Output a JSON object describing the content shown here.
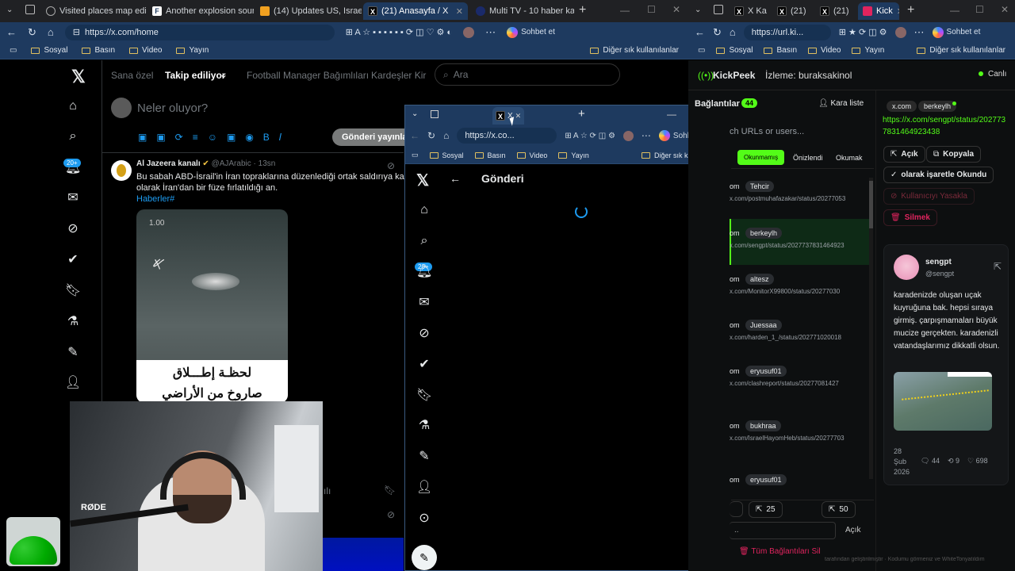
{
  "browser_main": {
    "tabs": [
      {
        "label": "",
        "icon": "vertical-tabs-icon"
      },
      {
        "label": "Visited places map editor",
        "icon": "globe-icon"
      },
      {
        "label": "Another explosion sound a",
        "icon": "generic-page-icon"
      },
      {
        "label": "(14) Updates US, Israel atta",
        "icon": "orange-site-icon"
      },
      {
        "label": "(21) Anasayfa / X",
        "icon": "x-logo-icon"
      },
      {
        "label": "Multi TV - 10 haber ka",
        "icon": "tv-icon"
      }
    ],
    "url": "https://x.com/home",
    "copilot_label": "Sohbet et",
    "bookmarks": [
      "Sosyal",
      "Basın",
      "Video",
      "Yayın"
    ],
    "other_bookmarks": "Diğer sık kullanılanlar"
  },
  "x_home": {
    "nav_tabs": [
      "Sana özel",
      "Takip ediliyor",
      "Football Manager Bağımlıları",
      "Kardeşler Kir"
    ],
    "search_placeholder": "Ara",
    "compose_placeholder": "Neler oluyor?",
    "post_button": "Gönderi yayınla",
    "notif_badge": "20+",
    "tweet": {
      "author": "Al Jazeera kanalı",
      "handle": "@AJArabic",
      "time": "13sn",
      "text_line1": "Bu sabah ABD-İsrail'in İran topraklarına düzenlediği ortak saldırıya karşılık",
      "text_line2": "olarak İran'dan bir füze fırlatıldığı an.",
      "hashtag": "Haberler#",
      "video_time": "1.00",
      "arabic_caption_1": "لحظـة إطـــلاق",
      "arabic_caption_2": "صاروخ من الأراضي"
    }
  },
  "popup": {
    "url": "https://x.co...",
    "copilot_label": "Sohbet et",
    "bookmarks": [
      "Sosyal",
      "Basın",
      "Video",
      "Yayın"
    ],
    "other_bookmarks": "Diğer sık kullanılanlar",
    "page_title": "Gönderi",
    "notif_badge": "20+"
  },
  "browser_right": {
    "tabs": [
      "X Ka",
      "(21)",
      "(21)",
      "Kick"
    ],
    "url": "https://url.ki...",
    "copilot_label": "Sohbet et",
    "bookmarks": [
      "Sosyal",
      "Basın",
      "Video",
      "Yayın"
    ],
    "other_bookmarks": "Diğer sık kullanılanlar"
  },
  "kickpeek": {
    "brand": "KickPeek",
    "watching": "İzleme: buraksakinol",
    "live_label": "Canlı",
    "links_label": "Bağlantılar",
    "links_count": "44",
    "blacklist": "Kara liste",
    "search_placeholder": "ch URLs or users...",
    "filter_tabs": [
      "Okunmamış",
      "Önizlendi",
      "Okumak"
    ],
    "rows": [
      {
        "prefix": "om",
        "user": "Tehcir",
        "url": "x.com/postmuhafazakar/status/20277053"
      },
      {
        "prefix": "om",
        "user": "berkeylh",
        "url": "x.com/sengpt/status/2027737831464923"
      },
      {
        "prefix": "om",
        "user": "altesz",
        "url": "x.com/MonitorX99800/status/20277030"
      },
      {
        "prefix": "om",
        "user": "Juessaa",
        "url": "x.com/harden_1_/status/202771020018"
      },
      {
        "prefix": "om",
        "user": "eryusuf01",
        "url": "x.com/clashreport/status/20277081427"
      },
      {
        "prefix": "om",
        "user": "bukhraa",
        "url": "x.com/IsraelHayomHeb/status/20277703"
      },
      {
        "prefix": "om",
        "user": "eryusuf01",
        "url": ""
      }
    ],
    "pager": [
      "25",
      "50"
    ],
    "bottom_action": "Açık",
    "delete_all": "Tüm Bağlantıları Sil",
    "footer": "tarafından geliştirilmiştir · Kodumu görmeniz ve WhiteTonyatıldım",
    "detail": {
      "domain": "x.com",
      "user": "berkeylh",
      "full_url": "https://x.com/sengpt/status/2027737831464923438",
      "actions": [
        "Açık",
        "Kopyala",
        "olarak işaretle Okundu",
        "Kullanıcıyı Yasakla",
        "Silmek"
      ],
      "card_name": "sengpt",
      "card_handle": "@sengpt",
      "card_text": "karadenizde oluşan uçak kuyruğuna bak. hepsi sıraya girmiş. çarpışmamaları büyük mucize gerçekten. karadenizli vatandaşlarımız dikkatli olsun.",
      "card_date_1": "28",
      "card_date_2": "Şub",
      "card_date_3": "2026",
      "replies": "44",
      "reposts": "9",
      "likes": "698"
    }
  },
  "colors": {
    "kick_green": "#53fc18",
    "edge_blue": "#1e3a5f",
    "x_blue": "#1d9bf0"
  }
}
